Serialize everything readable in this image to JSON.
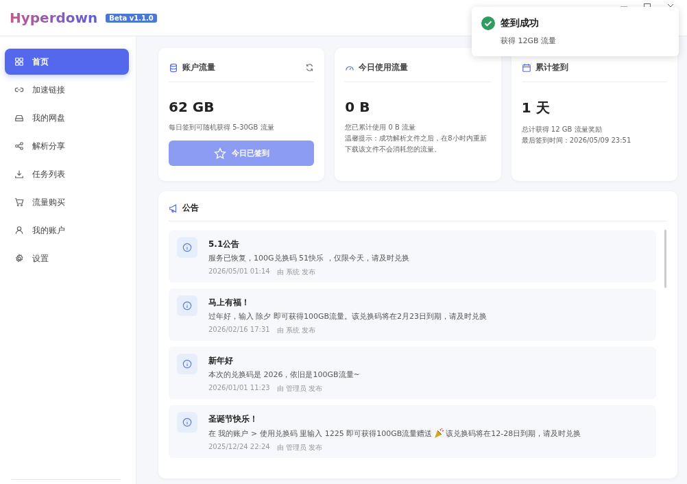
{
  "app": {
    "name": "Hyperdown",
    "version_badge": "Beta v1.1.0"
  },
  "sidebar": {
    "items": [
      {
        "label": "首页",
        "selected": true
      },
      {
        "label": "加速链接",
        "selected": false
      },
      {
        "label": "我的网盘",
        "selected": false
      },
      {
        "label": "解析分享",
        "selected": false
      },
      {
        "label": "任务列表",
        "selected": false
      },
      {
        "label": "流量购买",
        "selected": false
      },
      {
        "label": "我的账户",
        "selected": false
      },
      {
        "label": "设置",
        "selected": false
      }
    ]
  },
  "stats": [
    {
      "title": "账户流量",
      "value": "62 GB",
      "lines": [
        "每日签到可随机获得 5-30GB 流量"
      ],
      "button": {
        "label": "今日已签到",
        "disabled": true
      }
    },
    {
      "title": "今日使用流量",
      "value": "0 B",
      "lines": [
        "您已累计使用 0 B 流量",
        "温馨提示：成功解析文件之后，在8小时内重新下载该文件不会消耗您的流量。"
      ]
    },
    {
      "title": "累计签到",
      "value": "1 天",
      "lines": [
        "总计获得 12 GB 流量奖励",
        "最后签到时间：2026/05/09 23:51"
      ]
    }
  ],
  "announcements": {
    "title": "公告",
    "items": [
      {
        "title": "5.1公告",
        "body": "服务已恢复，100G兑换码 51快乐 ，仅限今天，请及时兑换",
        "time": "2026/05/01 01:14",
        "author": "由 系统 发布"
      },
      {
        "title": "马上有福！",
        "body": "过年好，输入 除夕 即可获得100GB流量。该兑换码将在2月23日到期，请及时兑换",
        "time": "2026/02/16 17:31",
        "author": "由 系统 发布"
      },
      {
        "title": "新年好",
        "body": "本次的兑换码是 2026，依旧是100GB流量~",
        "time": "2026/01/01 11:23",
        "author": "由 管理员 发布"
      },
      {
        "title": "圣诞节快乐！",
        "body": "在 我的账户 > 使用兑换码 里输入 1225 即可获得100GB流量赠送",
        "body_after_icon": "该兑换码将在12-28日到期，请及时兑换",
        "time": "2025/12/24 22:24",
        "author": "由 管理员 发布"
      }
    ]
  },
  "toast": {
    "title": "签到成功",
    "message": "获得 12GB 流量"
  }
}
